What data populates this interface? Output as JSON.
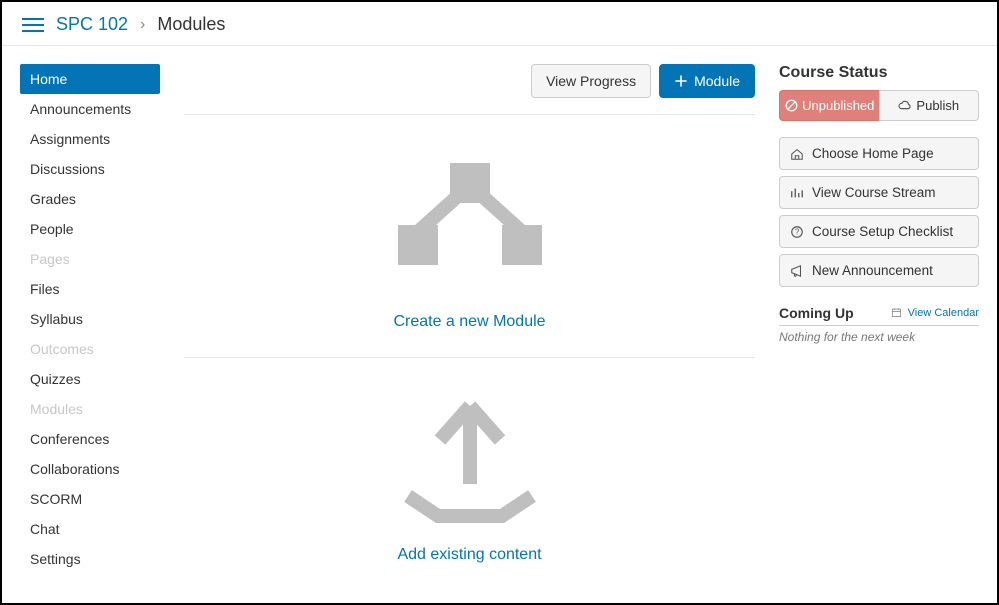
{
  "breadcrumb": {
    "course": "SPC 102",
    "current": "Modules"
  },
  "sidebar": {
    "items": [
      {
        "label": "Home",
        "active": true,
        "disabled": false
      },
      {
        "label": "Announcements",
        "active": false,
        "disabled": false
      },
      {
        "label": "Assignments",
        "active": false,
        "disabled": false
      },
      {
        "label": "Discussions",
        "active": false,
        "disabled": false
      },
      {
        "label": "Grades",
        "active": false,
        "disabled": false
      },
      {
        "label": "People",
        "active": false,
        "disabled": false
      },
      {
        "label": "Pages",
        "active": false,
        "disabled": true
      },
      {
        "label": "Files",
        "active": false,
        "disabled": false
      },
      {
        "label": "Syllabus",
        "active": false,
        "disabled": false
      },
      {
        "label": "Outcomes",
        "active": false,
        "disabled": true
      },
      {
        "label": "Quizzes",
        "active": false,
        "disabled": false
      },
      {
        "label": "Modules",
        "active": false,
        "disabled": true
      },
      {
        "label": "Conferences",
        "active": false,
        "disabled": false
      },
      {
        "label": "Collaborations",
        "active": false,
        "disabled": false
      },
      {
        "label": "SCORM",
        "active": false,
        "disabled": false
      },
      {
        "label": "Chat",
        "active": false,
        "disabled": false
      },
      {
        "label": "Settings",
        "active": false,
        "disabled": false
      }
    ]
  },
  "content_header": {
    "view_progress": "View Progress",
    "add_module": "Module"
  },
  "empty_states": {
    "create_module": "Create a new Module",
    "add_content": "Add existing content"
  },
  "right_panel": {
    "status_title": "Course Status",
    "unpublished": "Unpublished",
    "publish": "Publish",
    "actions": {
      "choose_home": "Choose Home Page",
      "view_stream": "View Course Stream",
      "setup_checklist": "Course Setup Checklist",
      "new_announcement": "New Announcement"
    },
    "coming_up": "Coming Up",
    "view_calendar": "View Calendar",
    "nothing": "Nothing for the next week"
  }
}
